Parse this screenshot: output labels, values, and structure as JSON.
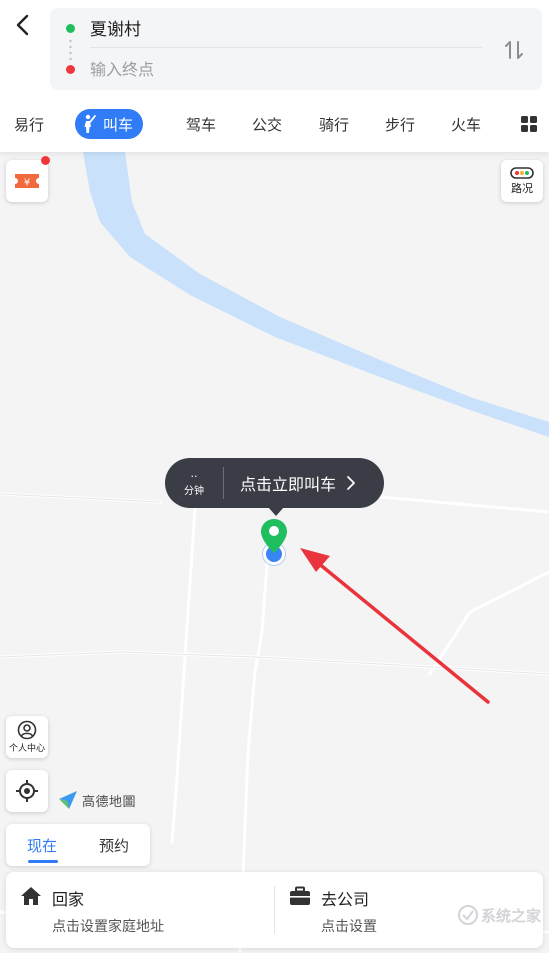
{
  "route": {
    "start_name": "夏谢村",
    "end_placeholder": "输入终点"
  },
  "tabs": [
    {
      "label": "易行"
    },
    {
      "label": "叫车",
      "active": true
    },
    {
      "label": "驾车"
    },
    {
      "label": "公交"
    },
    {
      "label": "骑行"
    },
    {
      "label": "步行"
    },
    {
      "label": "火车"
    }
  ],
  "map": {
    "traffic_label": "路况",
    "personal_center_label": "个人中心",
    "logo_text": "高德地圖",
    "bubble": {
      "eta_value": "..",
      "eta_unit": "分钟",
      "action_label": "点击立即叫车"
    },
    "river_color": "#c9e1fb",
    "arrow_color": "#e8343a"
  },
  "time_tabs": [
    {
      "label": "现在",
      "active": true
    },
    {
      "label": "预约"
    }
  ],
  "shortcuts": {
    "home": {
      "title": "回家",
      "subtitle": "点击设置家庭地址"
    },
    "work": {
      "title": "去公司",
      "subtitle": "点击设置"
    }
  },
  "watermark": {
    "text": "系统之家"
  },
  "colors": {
    "accent": "#2f7cf6",
    "start_dot": "#1fbf5f",
    "end_dot": "#f0353b"
  }
}
